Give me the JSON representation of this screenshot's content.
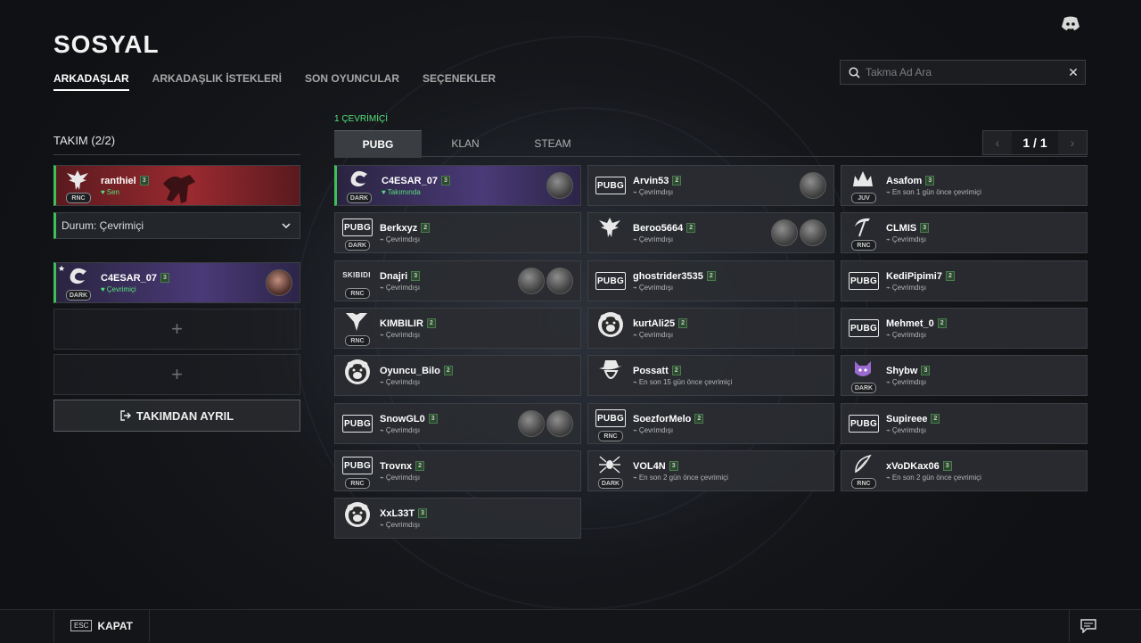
{
  "page_title": "SOSYAL",
  "tabs": [
    {
      "label": "ARKADAŞLAR",
      "active": true
    },
    {
      "label": "ARKADAŞLIK İSTEKLERİ",
      "active": false
    },
    {
      "label": "SON OYUNCULAR",
      "active": false
    },
    {
      "label": "SEÇENEKLER",
      "active": false
    }
  ],
  "search": {
    "placeholder": "Takma Ad Ara",
    "value": ""
  },
  "team": {
    "title": "TAKIM (2/2)",
    "me": {
      "name": "ranthiel",
      "level": "3",
      "status": "Sen",
      "rank": "RNC"
    },
    "status_dropdown": "Durum: Çevrimiçi",
    "member": {
      "name": "C4ESAR_07",
      "level": "3",
      "status": "Çevrimiçi",
      "rank": "DARK"
    },
    "leave_label": "TAKIMDAN AYRIL"
  },
  "online_count": "1 ÇEVRİMİÇİ",
  "friend_tabs": [
    {
      "label": "PUBG",
      "active": true
    },
    {
      "label": "KLAN",
      "active": false
    },
    {
      "label": "STEAM",
      "active": false
    }
  ],
  "pager": "1 / 1",
  "friends": [
    {
      "name": "C4ESAR_07",
      "level": "3",
      "status": "Takımında",
      "rank": "DARK",
      "emblem": "dragon",
      "online": true
    },
    {
      "name": "Arvin53",
      "level": "2",
      "status": "Çevrimdışı",
      "rank": "",
      "emblem": "pubg"
    },
    {
      "name": "Asafom",
      "level": "3",
      "status": "En son 1 gün önce çevrimiçi",
      "rank": "JUV",
      "emblem": "crown"
    },
    {
      "name": "Berkxyz",
      "level": "2",
      "status": "Çevrimdışı",
      "rank": "DARK",
      "emblem": "pubg"
    },
    {
      "name": "Beroo5664",
      "level": "2",
      "status": "Çevrimdışı",
      "rank": "",
      "emblem": "eagle"
    },
    {
      "name": "CLMIS",
      "level": "3",
      "status": "Çevrimdışı",
      "rank": "RNC",
      "emblem": "scythe"
    },
    {
      "name": "Dnajri",
      "level": "3",
      "status": "Çevrimdışı",
      "rank": "RNC",
      "emblem": "skibidi",
      "emblem_text": "SKIBIDI"
    },
    {
      "name": "ghostrider3535",
      "level": "2",
      "status": "Çevrimdışı",
      "rank": "",
      "emblem": "pubg"
    },
    {
      "name": "KediPipimi7",
      "level": "2",
      "status": "Çevrimdışı",
      "rank": "",
      "emblem": "pubg"
    },
    {
      "name": "KIMBILIR",
      "level": "2",
      "status": "Çevrimdışı",
      "rank": "RNC",
      "emblem": "wings"
    },
    {
      "name": "kurtAli25",
      "level": "2",
      "status": "Çevrimdışı",
      "rank": "",
      "emblem": "bear"
    },
    {
      "name": "Mehmet_0",
      "level": "2",
      "status": "Çevrimdışı",
      "rank": "",
      "emblem": "pubg"
    },
    {
      "name": "Oyuncu_Bilo",
      "level": "2",
      "status": "Çevrimdışı",
      "rank": "",
      "emblem": "bear"
    },
    {
      "name": "Possatt",
      "level": "2",
      "status": "En son 15 gün önce çevrimiçi",
      "rank": "",
      "emblem": "cowboy"
    },
    {
      "name": "Shybw",
      "level": "3",
      "status": "Çevrimdışı",
      "rank": "DARK",
      "emblem": "cat"
    },
    {
      "name": "SnowGL0",
      "level": "3",
      "status": "Çevrimdışı",
      "rank": "",
      "emblem": "pubg"
    },
    {
      "name": "SoezforMelo",
      "level": "2",
      "status": "Çevrimdışı",
      "rank": "RNC",
      "emblem": "pubg"
    },
    {
      "name": "Supireee",
      "level": "2",
      "status": "Çevrimdışı",
      "rank": "",
      "emblem": "pubg"
    },
    {
      "name": "Trovnx",
      "level": "2",
      "status": "Çevrimdışı",
      "rank": "RNC",
      "emblem": "pubg"
    },
    {
      "name": "VOL4N",
      "level": "3",
      "status": "En son 2 gün önce çevrimiçi",
      "rank": "DARK",
      "emblem": "spider"
    },
    {
      "name": "xVoDKax06",
      "level": "3",
      "status": "En son 2 gün önce çevrimiçi",
      "rank": "RNC",
      "emblem": "feather"
    },
    {
      "name": "XxL33T",
      "level": "3",
      "status": "Çevrimdışı",
      "rank": "",
      "emblem": "bear"
    }
  ],
  "footer": {
    "esc_key": "ESC",
    "close_label": "KAPAT"
  },
  "colors": {
    "online": "#3fbf5a",
    "status_green": "#55e07a",
    "background": "#101114"
  }
}
